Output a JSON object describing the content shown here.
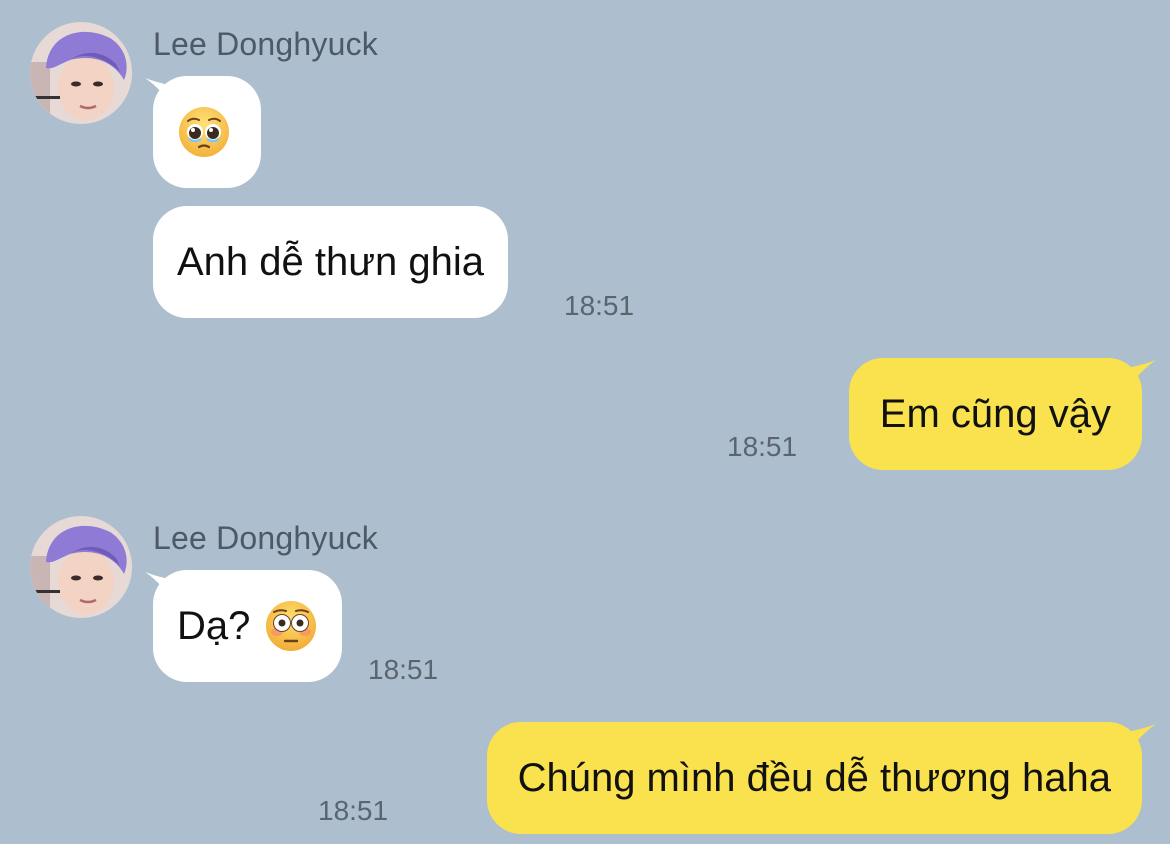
{
  "colors": {
    "background": "#adbfcf",
    "incoming_bubble": "#ffffff",
    "outgoing_bubble": "#f9e24e",
    "name_text": "#4d5966",
    "time_text": "#5b6570"
  },
  "messages": [
    {
      "direction": "incoming",
      "sender": "Lee Donghyuck",
      "avatar_icon": "profile-photo-avatar",
      "bubbles": [
        {
          "emoji": "pleading-face",
          "text": ""
        },
        {
          "text": "Anh dễ thưn ghia",
          "time": "18:51"
        }
      ]
    },
    {
      "direction": "outgoing",
      "bubbles": [
        {
          "text": "Em cũng vậy",
          "time": "18:51"
        }
      ]
    },
    {
      "direction": "incoming",
      "sender": "Lee Donghyuck",
      "avatar_icon": "profile-photo-avatar",
      "bubbles": [
        {
          "text": "Dạ?",
          "emoji": "flushed-face",
          "time": "18:51"
        }
      ]
    },
    {
      "direction": "outgoing",
      "bubbles": [
        {
          "text": "Chúng mình đều dễ thương haha",
          "time": "18:51"
        }
      ]
    }
  ]
}
